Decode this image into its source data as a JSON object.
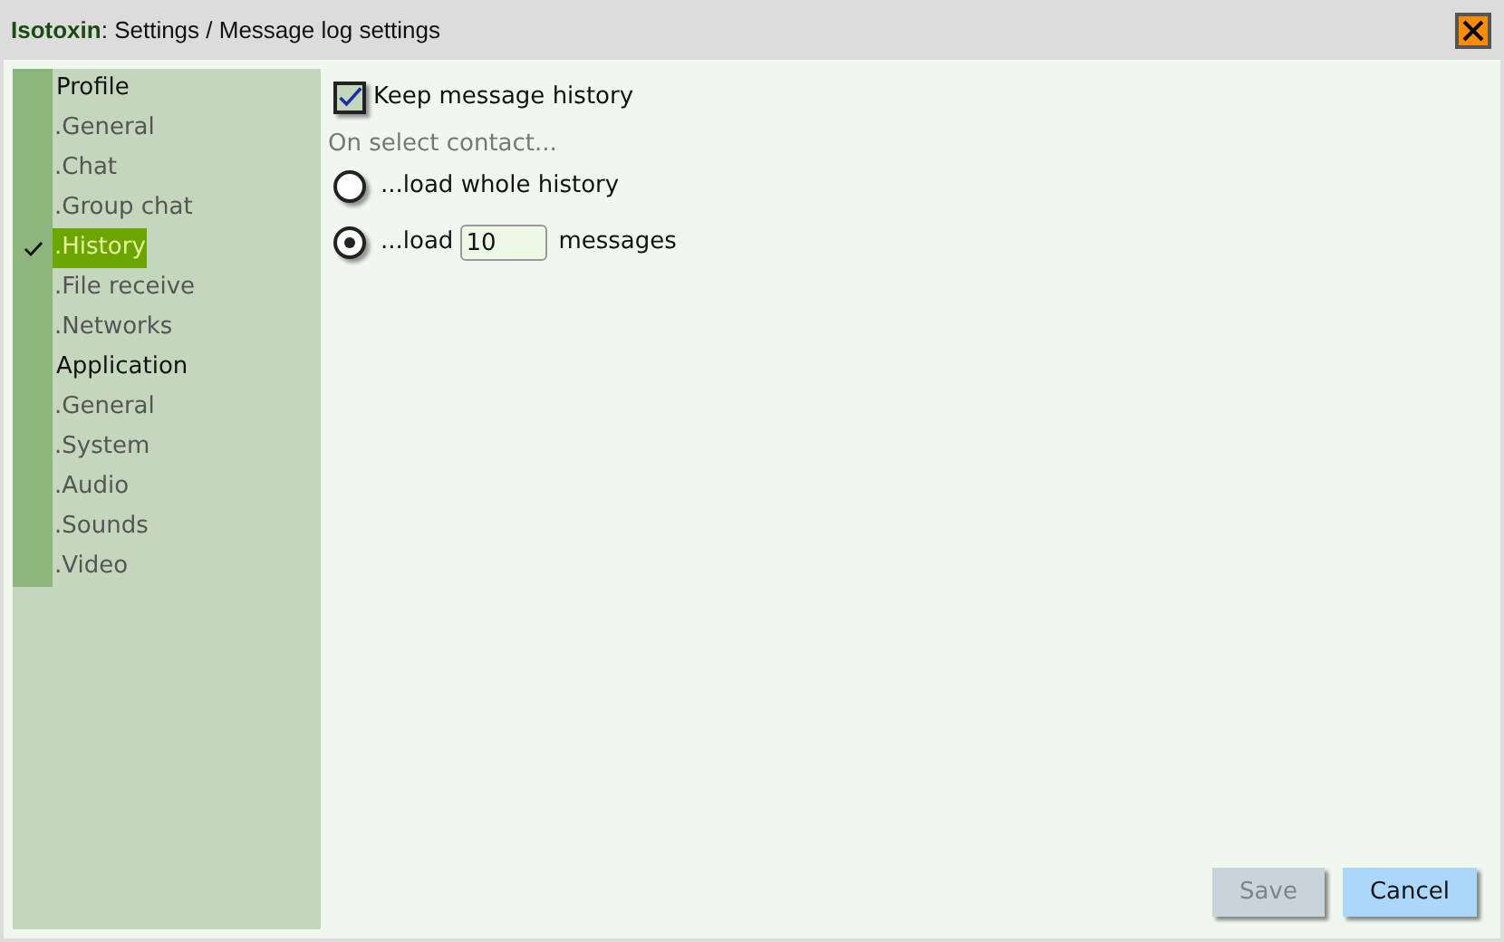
{
  "window": {
    "app_name": "Isotoxin",
    "title": ": Settings / Message log settings"
  },
  "sidebar": {
    "sections": [
      {
        "label": "Profile",
        "children": [
          {
            "label": ".General",
            "selected": false
          },
          {
            "label": ".Chat",
            "selected": false
          },
          {
            "label": ".Group chat",
            "selected": false
          },
          {
            "label": ".History",
            "selected": true
          },
          {
            "label": ".File receive",
            "selected": false
          },
          {
            "label": ".Networks",
            "selected": false
          }
        ]
      },
      {
        "label": "Application",
        "children": [
          {
            "label": ".General",
            "selected": false
          },
          {
            "label": ".System",
            "selected": false
          },
          {
            "label": ".Audio",
            "selected": false
          },
          {
            "label": ".Sounds",
            "selected": false
          },
          {
            "label": ".Video",
            "selected": false
          }
        ]
      }
    ]
  },
  "content": {
    "keep_history": {
      "label": "Keep message history",
      "checked": true
    },
    "group_label": "On select contact...",
    "options": [
      {
        "kind": "plain",
        "label": "...load whole history",
        "selected": false
      },
      {
        "kind": "count",
        "label": "...load",
        "value": "10",
        "suffix": "messages",
        "selected": true
      }
    ]
  },
  "buttons": [
    {
      "label": "Save",
      "disabled": true
    },
    {
      "label": "Cancel",
      "disabled": false
    }
  ]
}
